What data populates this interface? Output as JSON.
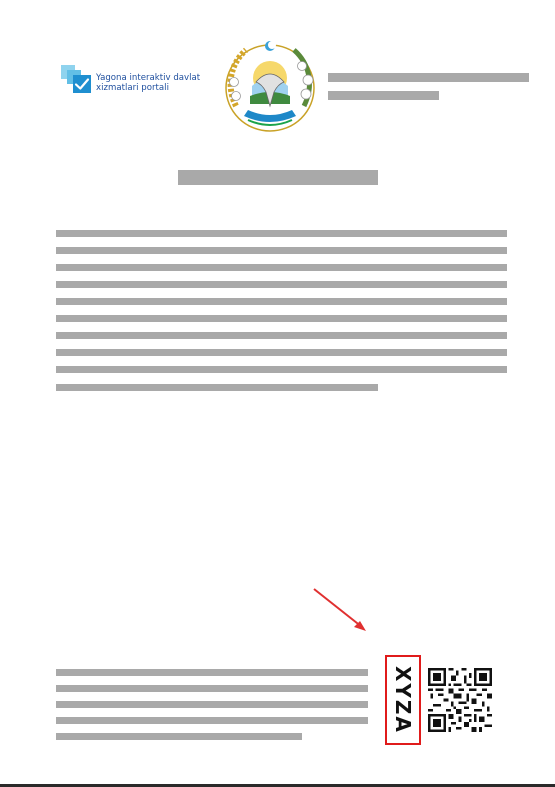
{
  "header": {
    "portal_logo": {
      "line1": "Yagona interaktiv davlat",
      "line2": "xizmatlari portali"
    },
    "emblem": {
      "icon": "state-emblem-icon"
    }
  },
  "verification": {
    "stamp_text": "XYZA",
    "stamp_color": "#e01b1b",
    "qr": {
      "icon": "qr-code-icon"
    },
    "arrow": {
      "icon": "arrow-pointer-icon",
      "color": "#e03030"
    }
  },
  "colors": {
    "redaction_bar": "#a9a9a9",
    "portal_text": "#1f4f9e",
    "portal_accent": "#1f8fd0"
  }
}
